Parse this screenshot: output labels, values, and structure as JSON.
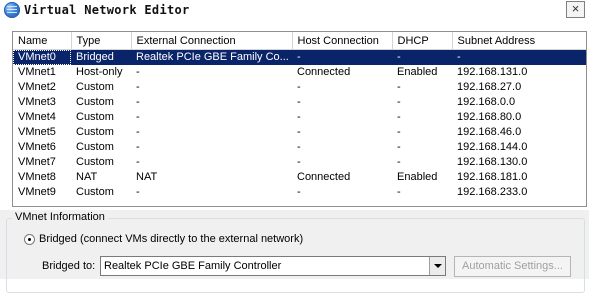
{
  "window": {
    "title": "Virtual Network Editor",
    "close_glyph": "×"
  },
  "columns": [
    "Name",
    "Type",
    "External Connection",
    "Host Connection",
    "DHCP",
    "Subnet Address"
  ],
  "rows": [
    {
      "name": "VMnet0",
      "type": "Bridged",
      "external": "Realtek PCIe GBE Family Co...",
      "host": "-",
      "dhcp": "-",
      "subnet": "-",
      "selected": true
    },
    {
      "name": "VMnet1",
      "type": "Host-only",
      "external": "-",
      "host": "Connected",
      "dhcp": "Enabled",
      "subnet": "192.168.131.0"
    },
    {
      "name": "VMnet2",
      "type": "Custom",
      "external": "-",
      "host": "-",
      "dhcp": "-",
      "subnet": "192.168.27.0"
    },
    {
      "name": "VMnet3",
      "type": "Custom",
      "external": "-",
      "host": "-",
      "dhcp": "-",
      "subnet": "192.168.0.0"
    },
    {
      "name": "VMnet4",
      "type": "Custom",
      "external": "-",
      "host": "-",
      "dhcp": "-",
      "subnet": "192.168.80.0"
    },
    {
      "name": "VMnet5",
      "type": "Custom",
      "external": "-",
      "host": "-",
      "dhcp": "-",
      "subnet": "192.168.46.0"
    },
    {
      "name": "VMnet6",
      "type": "Custom",
      "external": "-",
      "host": "-",
      "dhcp": "-",
      "subnet": "192.168.144.0"
    },
    {
      "name": "VMnet7",
      "type": "Custom",
      "external": "-",
      "host": "-",
      "dhcp": "-",
      "subnet": "192.168.130.0"
    },
    {
      "name": "VMnet8",
      "type": "NAT",
      "external": "NAT",
      "host": "Connected",
      "dhcp": "Enabled",
      "subnet": "192.168.181.0"
    },
    {
      "name": "VMnet9",
      "type": "Custom",
      "external": "-",
      "host": "-",
      "dhcp": "-",
      "subnet": "192.168.233.0"
    }
  ],
  "vmnet_info": {
    "legend": "VMnet Information",
    "bridged_radio_label": "Bridged (connect VMs directly to the external network)",
    "bridged_to_label": "Bridged to:",
    "bridged_to_value": "Realtek PCIe GBE Family Controller",
    "automatic_settings_label": "Automatic Settings..."
  },
  "colors": {
    "selection": "#0a246a",
    "panel_bg": "#f0f0f0"
  }
}
